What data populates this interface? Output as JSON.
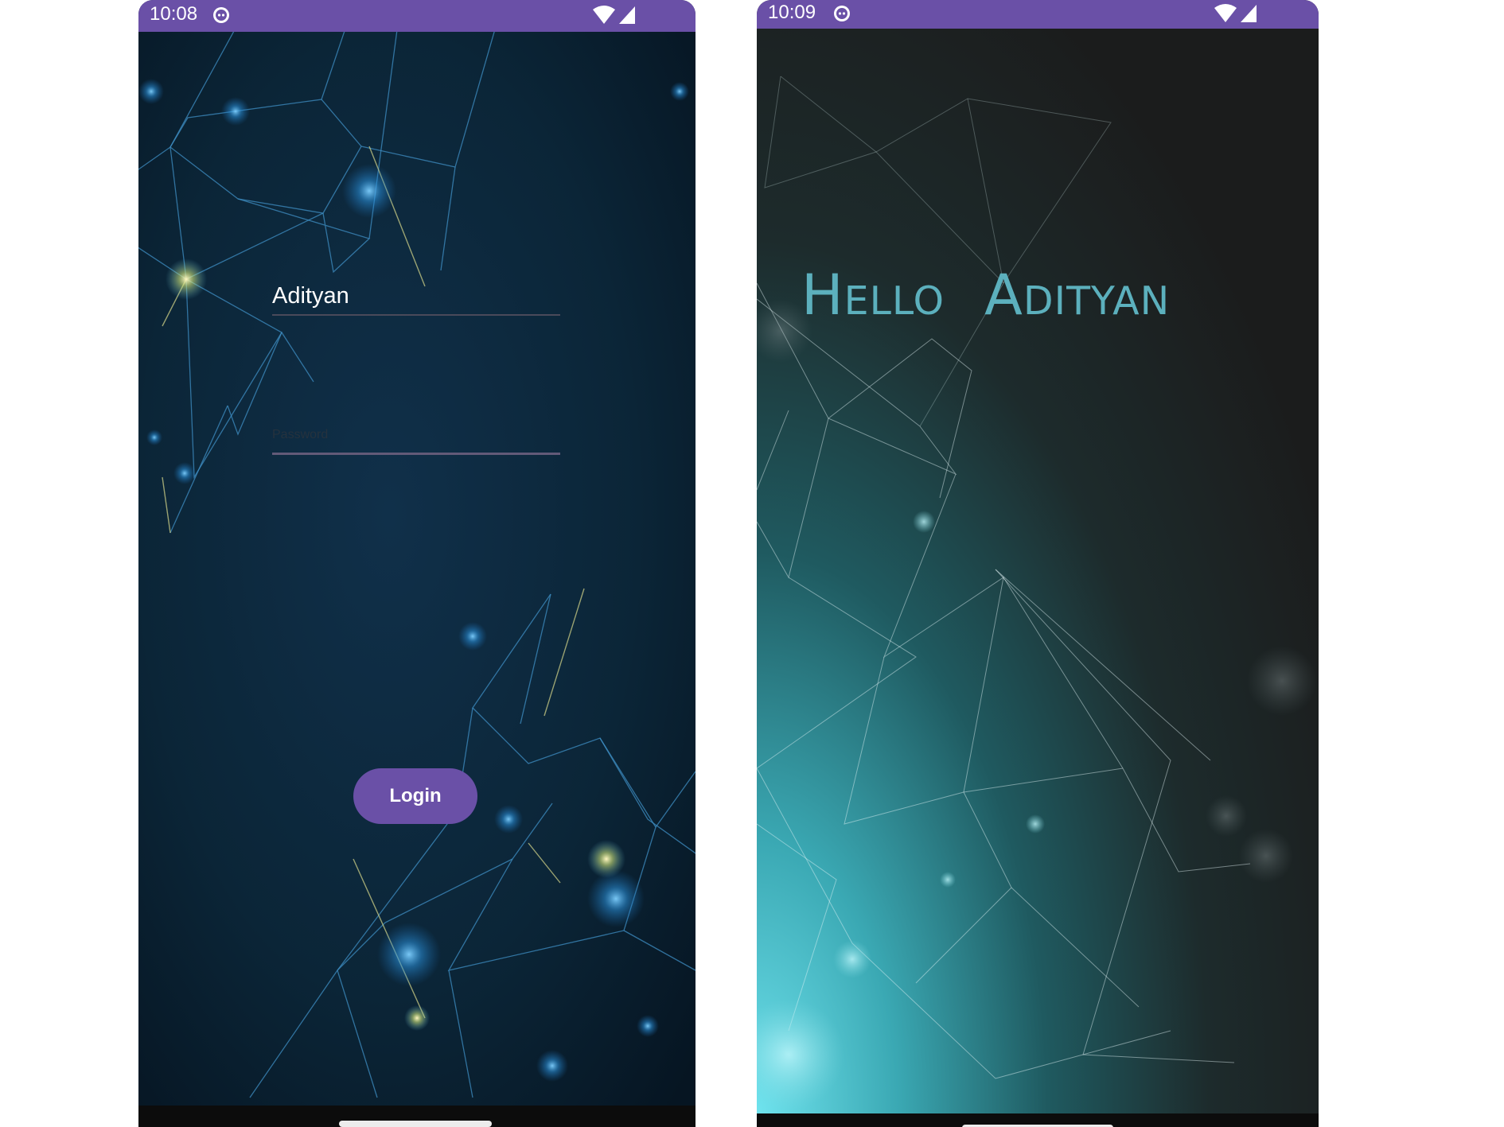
{
  "colors": {
    "status_bar": "#6a50a7",
    "accent": "#6a50a7",
    "login_background": "#0a2232",
    "hello_background": "#1b1c1c",
    "greeting_text": "#5cb0bd"
  },
  "login_screen": {
    "status_bar": {
      "time": "10:08",
      "icons": [
        "notification-app-icon",
        "wifi-icon",
        "signal-icon"
      ]
    },
    "username": {
      "value": "Adityan"
    },
    "password": {
      "value": "",
      "placeholder": "Password"
    },
    "login_button": {
      "label": "Login"
    }
  },
  "hello_screen": {
    "status_bar": {
      "time": "10:09",
      "icons": [
        "notification-app-icon",
        "wifi-icon",
        "signal-icon"
      ]
    },
    "greeting": {
      "word1": "Hello",
      "word2": "Adityan"
    }
  }
}
